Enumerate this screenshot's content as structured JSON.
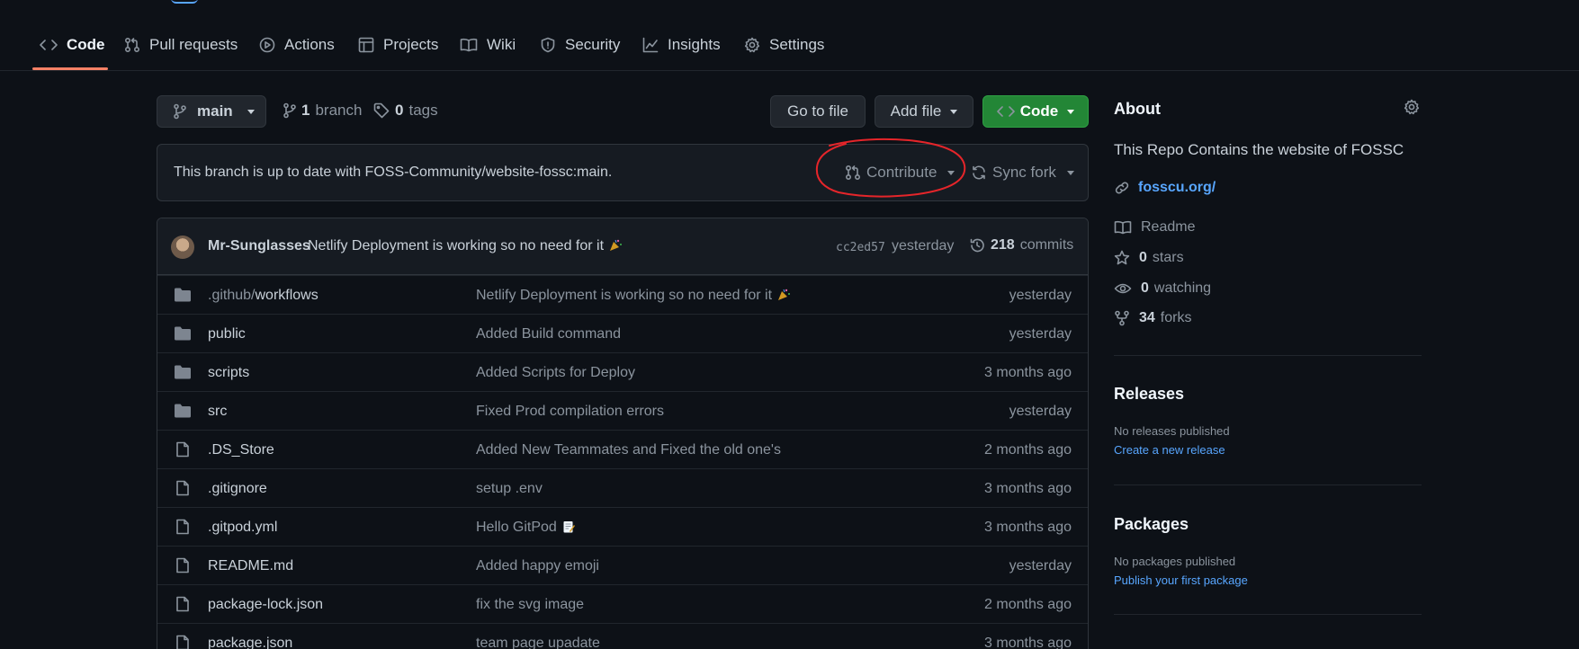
{
  "nav": {
    "tabs": [
      {
        "label": "Code",
        "icon": "code-icon",
        "active": true
      },
      {
        "label": "Pull requests",
        "icon": "pull-request-icon"
      },
      {
        "label": "Actions",
        "icon": "play-icon"
      },
      {
        "label": "Projects",
        "icon": "table-icon"
      },
      {
        "label": "Wiki",
        "icon": "book-icon"
      },
      {
        "label": "Security",
        "icon": "shield-icon"
      },
      {
        "label": "Insights",
        "icon": "graph-icon"
      },
      {
        "label": "Settings",
        "icon": "gear-icon"
      }
    ]
  },
  "toolbar": {
    "branch_label": "main",
    "branch_count": "1",
    "branch_word": "branch",
    "tag_count": "0",
    "tag_word": "tags",
    "go_to_file": "Go to file",
    "add_file": "Add file",
    "code_button": "Code"
  },
  "branch_status": {
    "message": "This branch is up to date with FOSS-Community/website-fossc:main.",
    "contribute": "Contribute",
    "sync_fork": "Sync fork",
    "annotation_color": "#e5252a"
  },
  "latest_commit": {
    "author": "Mr-Sunglasses",
    "message": "Netlify Deployment is working so no need for it",
    "sha": "cc2ed57",
    "time": "yesterday",
    "commit_count": "218",
    "commit_word": "commits"
  },
  "files": [
    {
      "type": "dir",
      "name_prefix": ".github/",
      "name": "workflows",
      "message": "Netlify Deployment is working so no need for it",
      "emoji": "party-popper",
      "time": "yesterday"
    },
    {
      "type": "dir",
      "name_prefix": "",
      "name": "public",
      "message": "Added Build command",
      "emoji": "",
      "time": "yesterday"
    },
    {
      "type": "dir",
      "name_prefix": "",
      "name": "scripts",
      "message": "Added Scripts for Deploy",
      "emoji": "",
      "time": "3 months ago"
    },
    {
      "type": "dir",
      "name_prefix": "",
      "name": "src",
      "message": "Fixed Prod compilation errors",
      "emoji": "",
      "time": "yesterday"
    },
    {
      "type": "file",
      "name_prefix": "",
      "name": ".DS_Store",
      "message": "Added New Teammates and Fixed the old one's",
      "emoji": "",
      "time": "2 months ago"
    },
    {
      "type": "file",
      "name_prefix": "",
      "name": ".gitignore",
      "message": "setup .env",
      "emoji": "",
      "time": "3 months ago"
    },
    {
      "type": "file",
      "name_prefix": "",
      "name": ".gitpod.yml",
      "message": "Hello GitPod",
      "emoji": "memo",
      "time": "3 months ago"
    },
    {
      "type": "file",
      "name_prefix": "",
      "name": "README.md",
      "message": "Added happy emoji",
      "emoji": "",
      "time": "yesterday"
    },
    {
      "type": "file",
      "name_prefix": "",
      "name": "package-lock.json",
      "message": "fix the svg image",
      "emoji": "",
      "time": "2 months ago"
    },
    {
      "type": "file",
      "name_prefix": "",
      "name": "package.json",
      "message": "team page upadate",
      "emoji": "",
      "time": "3 months ago"
    }
  ],
  "about": {
    "title": "About",
    "description": "This Repo Contains the website of FOSSC",
    "website": "fosscu.org/",
    "readme": "Readme",
    "stars_count": "0",
    "stars_word": "stars",
    "watching_count": "0",
    "watching_word": "watching",
    "forks_count": "34",
    "forks_word": "forks"
  },
  "releases": {
    "title": "Releases",
    "empty": "No releases published",
    "create_link": "Create a new release"
  },
  "packages": {
    "title": "Packages",
    "empty": "No packages published",
    "publish_link": "Publish your first package"
  },
  "colors": {
    "accent": "#58a6ff",
    "green": "#238636",
    "tab_underline": "#f78166",
    "background": "#0d1117"
  }
}
